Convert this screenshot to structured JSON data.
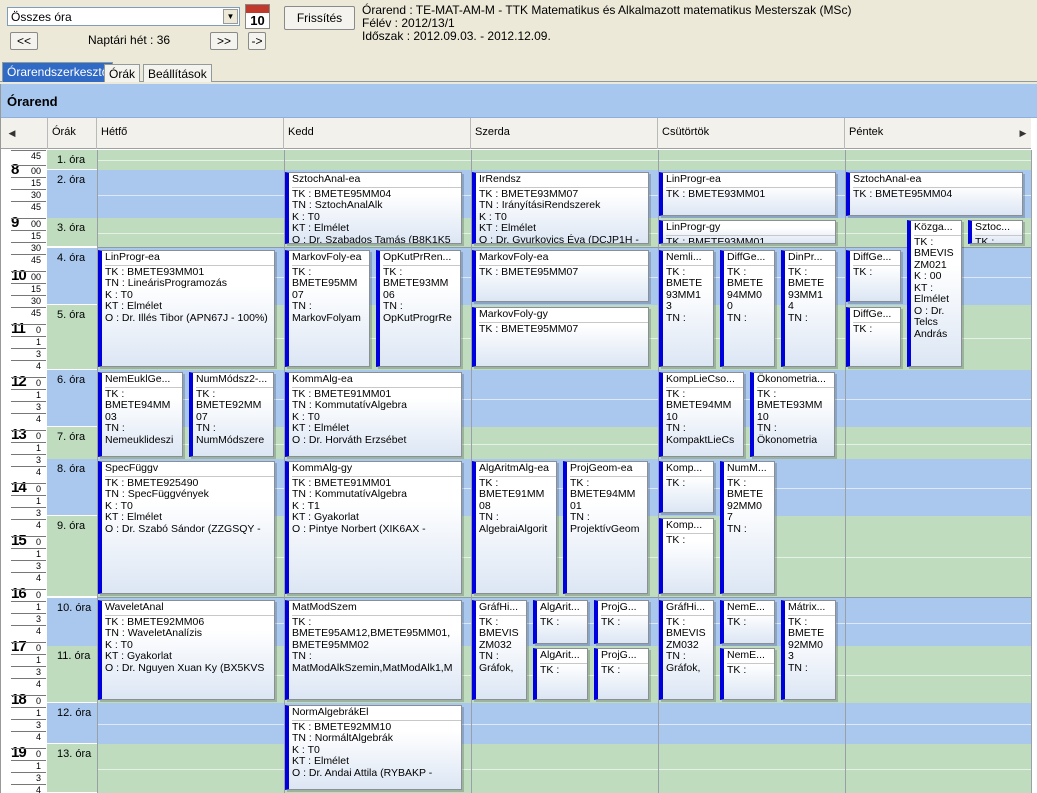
{
  "toolbar": {
    "select_value": "Összes óra",
    "cal_day": "10",
    "refresh_label": "Frissítés",
    "prev_label": "<<",
    "next_label": ">>",
    "go_label": "->",
    "week_label": "Naptári hét : 36"
  },
  "info": {
    "line1": "Órarend : TE-MAT-AM-M - TTK Matematikus és Alkalmazott matematikus Mesterszak (MSc)",
    "line2": "Félév : 2012/13/1",
    "line3": "Időszak : 2012.09.03. - 2012.12.09."
  },
  "tabs": [
    {
      "label": "Órarendszerkesztő",
      "active": true
    },
    {
      "label": "Órák",
      "active": false
    },
    {
      "label": "Beállítások",
      "active": false
    }
  ],
  "banner_title": "Órarend",
  "header": {
    "col_ora": "Órák",
    "days": [
      "Hétfő",
      "Kedd",
      "Szerda",
      "Csütörtök",
      "Péntek"
    ]
  },
  "slots": [
    "1. óra",
    "2. óra",
    "3. óra",
    "4. óra",
    "5. óra",
    "6. óra",
    "7. óra",
    "8. óra",
    "9. óra",
    "10. óra",
    "11. óra",
    "12. óra",
    "13. óra"
  ],
  "ruler": {
    "hours": [
      "8",
      "9",
      "10",
      "11",
      "12",
      "13",
      "14",
      "15",
      "16",
      "17",
      "18",
      "19"
    ],
    "minute_ticks": [
      "00",
      "15",
      "30",
      "45"
    ],
    "first_tick": "45",
    "short_ticks": [
      "0",
      "1",
      "3",
      "4"
    ]
  },
  "colors": {
    "blue_lane": "#aac8ee",
    "green_lane": "#bfdcbf",
    "event_bar": "#0000dd"
  },
  "events": [
    {
      "day": 1,
      "slot": 1,
      "span": 2,
      "sub": 0,
      "subs": 1,
      "lines": [
        "SztochAnal-ea",
        "TK : BMETE95MM04",
        "TN : SztochAnalAlk",
        "K : T0",
        "KT : Elmélet",
        "O :  Dr. Szabados Tamás (B8K1K5"
      ]
    },
    {
      "day": 2,
      "slot": 1,
      "span": 2,
      "sub": 0,
      "subs": 1,
      "lines": [
        "IrRendsz",
        "TK : BMETE93MM07",
        "TN : IrányításiRendszerek",
        "K : T0",
        "KT : Elmélet",
        "O :  Dr. Gyurkovics Éva (DCJP1H -"
      ]
    },
    {
      "day": 3,
      "slot": 1,
      "span": 1,
      "sub": 0,
      "subs": 1,
      "lines": [
        "LinProgr-ea",
        "TK : BMETE93MM01"
      ]
    },
    {
      "day": 4,
      "slot": 1,
      "span": 1,
      "sub": 0,
      "subs": 1,
      "lines": [
        "SztochAnal-ea",
        "TK : BMETE95MM04"
      ]
    },
    {
      "day": 3,
      "slot": 2,
      "span": 1,
      "sub": 0,
      "subs": 1,
      "lines": [
        "LinProgr-gy",
        "TK : BMETE93MM01"
      ]
    },
    {
      "day": 4,
      "slot": 2,
      "span": 3,
      "sub": 1,
      "subs": 3,
      "lines": [
        "Közga...",
        "TK :",
        "BMEVIS",
        "ZM021",
        "K : 00",
        "KT :",
        "Elmélet",
        "O :  Dr.",
        "Telcs",
        "András"
      ]
    },
    {
      "day": 4,
      "slot": 2,
      "span": 1,
      "sub": 2,
      "subs": 3,
      "lines": [
        "Sztoc...",
        "TK :"
      ]
    },
    {
      "day": 0,
      "slot": 3,
      "span": 2,
      "sub": 0,
      "subs": 1,
      "lines": [
        "LinProgr-ea",
        "TK : BMETE93MM01",
        "TN : LineárisProgramozás",
        "K : T0",
        "KT : Elmélet",
        "O :  Dr. Illés Tibor (APN67J - 100%)"
      ]
    },
    {
      "day": 1,
      "slot": 3,
      "span": 2,
      "sub": 0,
      "subs": 2,
      "lines": [
        "MarkovFoly-ea",
        "TK :",
        "BMETE95MM",
        "07",
        "TN :",
        "MarkovFolyam"
      ]
    },
    {
      "day": 1,
      "slot": 3,
      "span": 2,
      "sub": 1,
      "subs": 2,
      "lines": [
        "OpKutPrRen...",
        "TK :",
        "BMETE93MM",
        "06",
        "TN :",
        "OpKutProgrRe"
      ]
    },
    {
      "day": 2,
      "slot": 3,
      "span": 1,
      "sub": 0,
      "subs": 1,
      "lines": [
        "MarkovFoly-ea",
        "TK : BMETE95MM07"
      ]
    },
    {
      "day": 2,
      "slot": 4,
      "span": 1,
      "sub": 0,
      "subs": 1,
      "lines": [
        "MarkovFoly-gy",
        "TK : BMETE95MM07"
      ]
    },
    {
      "day": 3,
      "slot": 3,
      "span": 2,
      "sub": 0,
      "subs": 3,
      "lines": [
        "Nemli...",
        "TK :",
        "BMETE",
        "93MM1",
        "3",
        "TN :"
      ]
    },
    {
      "day": 3,
      "slot": 3,
      "span": 2,
      "sub": 1,
      "subs": 3,
      "lines": [
        "DiffGe...",
        "TK :",
        "BMETE",
        "94MM0",
        "0",
        "TN :"
      ]
    },
    {
      "day": 3,
      "slot": 3,
      "span": 2,
      "sub": 2,
      "subs": 3,
      "lines": [
        "DinPr...",
        "TK :",
        "BMETE",
        "93MM1",
        "4",
        "TN :"
      ]
    },
    {
      "day": 4,
      "slot": 3,
      "span": 1,
      "sub": 0,
      "subs": 3,
      "lines": [
        "DiffGe...",
        "TK :"
      ]
    },
    {
      "day": 4,
      "slot": 4,
      "span": 1,
      "sub": 0,
      "subs": 3,
      "lines": [
        "DiffGe...",
        "TK :"
      ]
    },
    {
      "day": 0,
      "slot": 5,
      "span": 2,
      "sub": 0,
      "subs": 2,
      "lines": [
        "NemEuklGe...",
        "TK :",
        "BMETE94MM",
        "03",
        "TN :",
        "Nemeuklideszi"
      ]
    },
    {
      "day": 0,
      "slot": 5,
      "span": 2,
      "sub": 1,
      "subs": 2,
      "lines": [
        "NumMódsz2-...",
        "TK :",
        "BMETE92MM",
        "07",
        "TN :",
        "NumMódszere"
      ]
    },
    {
      "day": 1,
      "slot": 5,
      "span": 2,
      "sub": 0,
      "subs": 1,
      "lines": [
        "KommAlg-ea",
        "TK : BMETE91MM01",
        "TN : KommutatívAlgebra",
        "K : T0",
        "KT : Elmélet",
        "O :  Dr. Horváth Erzsébet"
      ]
    },
    {
      "day": 3,
      "slot": 5,
      "span": 2,
      "sub": 0,
      "subs": 2,
      "lines": [
        "KompLieCso...",
        "TK :",
        "BMETE94MM",
        "10",
        "TN :",
        "KompaktLieCs"
      ]
    },
    {
      "day": 3,
      "slot": 5,
      "span": 2,
      "sub": 1,
      "subs": 2,
      "lines": [
        "Ökonometria...",
        "TK :",
        "BMETE93MM",
        "10",
        "TN :",
        "Ökonometria"
      ]
    },
    {
      "day": 0,
      "slot": 7,
      "span": 2,
      "sub": 0,
      "subs": 1,
      "lines": [
        "SpecFüggv",
        "TK : BMETE925490",
        "TN : SpecFüggvények",
        "K : T0",
        "KT : Elmélet",
        "O :  Dr. Szabó Sándor (ZZGSQY -"
      ]
    },
    {
      "day": 1,
      "slot": 7,
      "span": 2,
      "sub": 0,
      "subs": 1,
      "lines": [
        "KommAlg-gy",
        "TK : BMETE91MM01",
        "TN : KommutatívAlgebra",
        "K : T1",
        "KT : Gyakorlat",
        "O :  Pintye Norbert (XIK6AX -"
      ]
    },
    {
      "day": 2,
      "slot": 7,
      "span": 2,
      "sub": 0,
      "subs": 2,
      "lines": [
        "AlgAritmAlg-ea",
        "TK :",
        "BMETE91MM",
        "08",
        "TN :",
        "AlgebraiAlgorit"
      ]
    },
    {
      "day": 2,
      "slot": 7,
      "span": 2,
      "sub": 1,
      "subs": 2,
      "lines": [
        "ProjGeom-ea",
        "TK :",
        "BMETE94MM",
        "01",
        "TN :",
        "ProjektívGeom"
      ]
    },
    {
      "day": 3,
      "slot": 7,
      "span": 1,
      "sub": 0,
      "subs": 3,
      "lines": [
        "Komp...",
        "TK :"
      ]
    },
    {
      "day": 3,
      "slot": 8,
      "span": 1,
      "sub": 0,
      "subs": 3,
      "lines": [
        "Komp...",
        "TK :"
      ]
    },
    {
      "day": 3,
      "slot": 7,
      "span": 2,
      "sub": 1,
      "subs": 3,
      "lines": [
        "NumM...",
        "TK :",
        "BMETE",
        "92MM0",
        "7",
        "TN :"
      ]
    },
    {
      "day": 0,
      "slot": 9,
      "span": 2,
      "sub": 0,
      "subs": 1,
      "lines": [
        "WaveletAnal",
        "TK : BMETE92MM06",
        "TN : WaveletAnalízis",
        "K : T0",
        "KT : Gyakorlat",
        "O :  Dr. Nguyen Xuan Ky (BX5KVS"
      ]
    },
    {
      "day": 1,
      "slot": 9,
      "span": 2,
      "sub": 0,
      "subs": 1,
      "lines": [
        "MatModSzem",
        "TK :",
        "BMETE95AM12,BMETE95MM01,",
        "BMETE95MM02",
        "TN :",
        "MatModAlkSzemin,MatModAlk1,M"
      ]
    },
    {
      "day": 2,
      "slot": 9,
      "span": 2,
      "sub": 0,
      "subs": 3,
      "lines": [
        "GráfHi...",
        "TK :",
        "BMEVIS",
        "ZM032",
        "TN :",
        "Gráfok,"
      ]
    },
    {
      "day": 2,
      "slot": 9,
      "span": 1,
      "sub": 1,
      "subs": 3,
      "lines": [
        "AlgArit...",
        "TK :"
      ]
    },
    {
      "day": 2,
      "slot": 9,
      "span": 1,
      "sub": 2,
      "subs": 3,
      "lines": [
        "ProjG...",
        "TK :"
      ]
    },
    {
      "day": 2,
      "slot": 10,
      "span": 1,
      "sub": 1,
      "subs": 3,
      "lines": [
        "AlgArit...",
        "TK :"
      ]
    },
    {
      "day": 2,
      "slot": 10,
      "span": 1,
      "sub": 2,
      "subs": 3,
      "lines": [
        "ProjG...",
        "TK :"
      ]
    },
    {
      "day": 3,
      "slot": 9,
      "span": 2,
      "sub": 0,
      "subs": 3,
      "lines": [
        "GráfHi...",
        "TK :",
        "BMEVIS",
        "ZM032",
        "TN :",
        "Gráfok,"
      ]
    },
    {
      "day": 3,
      "slot": 9,
      "span": 1,
      "sub": 1,
      "subs": 3,
      "lines": [
        "NemE...",
        "TK :"
      ]
    },
    {
      "day": 3,
      "slot": 10,
      "span": 1,
      "sub": 1,
      "subs": 3,
      "lines": [
        "NemE...",
        "TK :"
      ]
    },
    {
      "day": 3,
      "slot": 9,
      "span": 2,
      "sub": 2,
      "subs": 3,
      "lines": [
        "Mátrix...",
        "TK :",
        "BMETE",
        "92MM0",
        "3",
        "TN :"
      ]
    },
    {
      "day": 1,
      "slot": 11,
      "span": 2,
      "sub": 0,
      "subs": 1,
      "lines": [
        "NormAlgebrákEl",
        "TK : BMETE92MM10",
        "TN : NormáltAlgebrák",
        "K : T0",
        "KT : Elmélet",
        "O :  Dr. Andai Attila (RYBAKP -"
      ]
    }
  ]
}
